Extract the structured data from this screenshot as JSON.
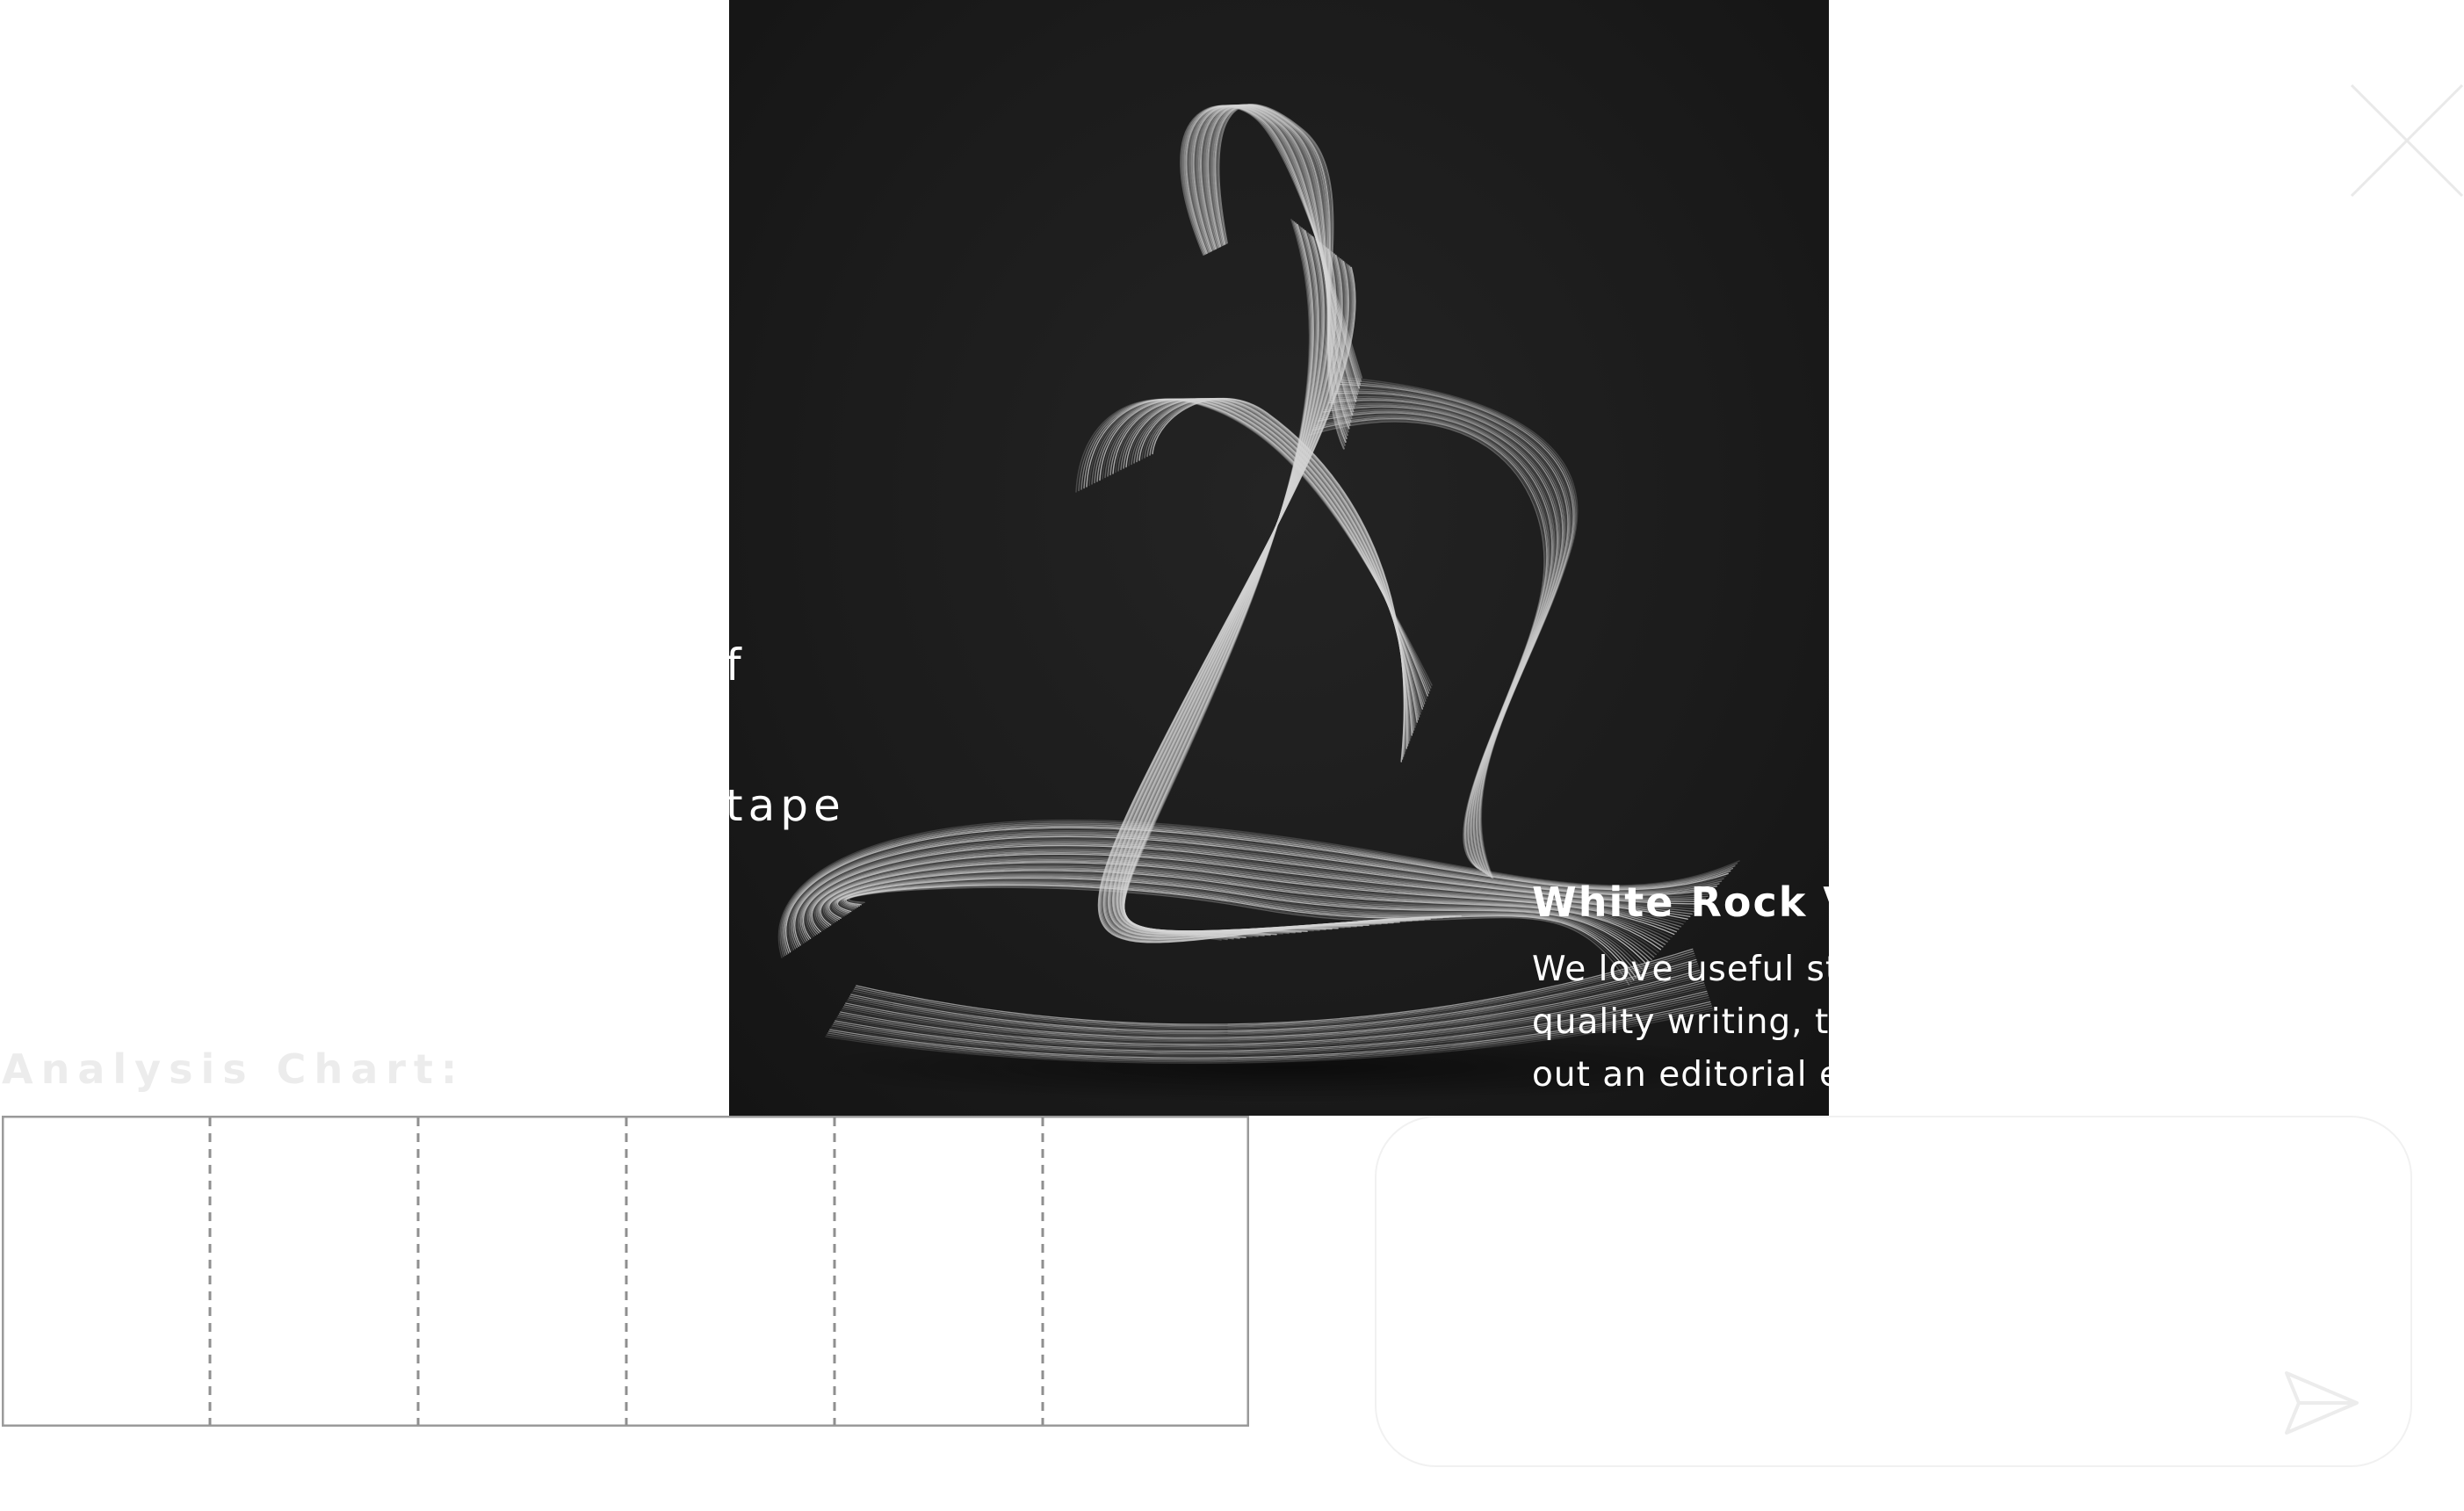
{
  "hero": {
    "ghost_lines": [
      "f",
      "tape"
    ]
  },
  "caption": {
    "title": "White Rock Vineyards",
    "body": "We love useful stuff, and we love quality writing, that's why we send out an editorial email newslet"
  },
  "chart": {
    "heading": "Analysis Chart:"
  },
  "message": {
    "placeholder": ""
  },
  "icons": {
    "close": "close-icon",
    "send": "send-icon"
  },
  "colors": {
    "hero_background": "#1b1b1b",
    "sculpture": "#e6e6e6",
    "chart_border": "#9a9a9a",
    "card_border": "#f1f1f1"
  }
}
